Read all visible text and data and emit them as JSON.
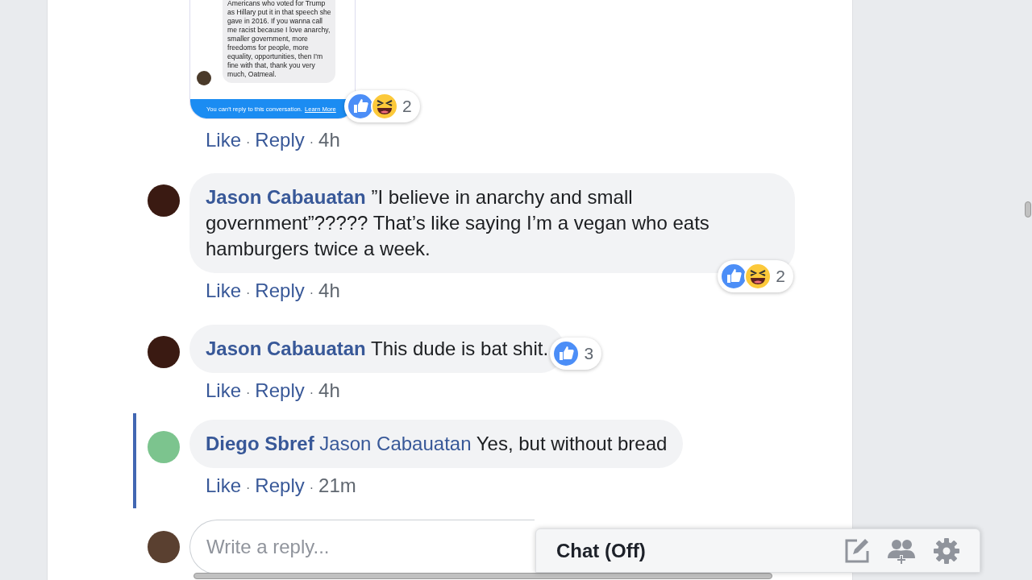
{
  "shared_image": {
    "message": "Americans who voted for Trump as Hillary put it in that speech she gave in 2016. If you wanna call me racist because I love anarchy, smaller government, more freedoms for people, more equality, opportunities, then I'm fine with that, thank you very much, Oatmeal.",
    "footer": "You can't reply to this conversation.",
    "footer_link": "Learn More",
    "reactions": {
      "types": [
        {
          "kind": "like"
        },
        {
          "kind": "haha"
        }
      ],
      "count": "2"
    },
    "actions": [
      "Like",
      "Reply"
    ],
    "separators": [
      "·",
      "·"
    ],
    "time": "4h"
  },
  "comments": [
    {
      "author": "Jason Cabauatan",
      "text": "”I believe in anarchy and small government”????? That’s like saying I’m a vegan who eats hamburgers twice a week.",
      "color": "#3a1a12",
      "highlighted": false,
      "reactions": {
        "types": [
          {
            "kind": "like"
          },
          {
            "kind": "haha"
          }
        ],
        "count": "2"
      },
      "actions": [
        "Like",
        "Reply"
      ],
      "separators": [
        "·",
        "·"
      ],
      "time": "4h"
    },
    {
      "author": "Jason Cabauatan",
      "text": "This dude is bat shit.",
      "color": "#3a1a12",
      "highlighted": false,
      "reactions": {
        "types": [
          {
            "kind": "like"
          }
        ],
        "count": "3"
      },
      "actions": [
        "Like",
        "Reply"
      ],
      "separators": [
        "·",
        "·"
      ],
      "time": "4h"
    },
    {
      "author": "Diego Sbref",
      "mention": "Jason Cabauatan",
      "text": "Yes, but without bread",
      "color": "#7cc48e",
      "highlighted": true,
      "actions": [
        "Like",
        "Reply"
      ],
      "separators": [
        "·",
        "·"
      ],
      "time": "21m"
    }
  ],
  "reply_box": {
    "placeholder": "Write a reply...",
    "color": "#5a4030"
  },
  "chat": {
    "title": "Chat (Off)"
  }
}
